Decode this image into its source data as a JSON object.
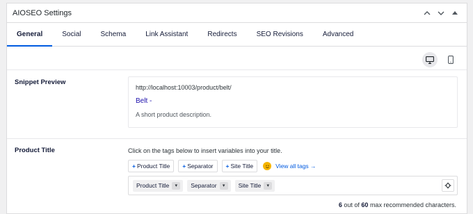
{
  "panel": {
    "title": "AIOSEO Settings"
  },
  "tabs": [
    {
      "label": "General"
    },
    {
      "label": "Social"
    },
    {
      "label": "Schema"
    },
    {
      "label": "Link Assistant"
    },
    {
      "label": "Redirects"
    },
    {
      "label": "SEO Revisions"
    },
    {
      "label": "Advanced"
    }
  ],
  "snippet": {
    "label": "Snippet Preview",
    "url": "http://localhost:10003/product/belt/",
    "title": "Belt -",
    "description": "A short product description."
  },
  "product_title": {
    "label": "Product Title",
    "help": "Click on the tags below to insert variables into your title.",
    "tags": [
      {
        "label": "Product Title"
      },
      {
        "label": "Separator"
      },
      {
        "label": "Site Title"
      }
    ],
    "view_all": "View all tags →",
    "chips": [
      {
        "label": "Product Title"
      },
      {
        "label": "Separator"
      },
      {
        "label": "Site Title"
      }
    ],
    "count": "6",
    "max": "60",
    "count_middle": "out of",
    "count_suffix": "max recommended characters."
  },
  "colors": {
    "accent": "#005ae0",
    "snippet_link": "#1a0dab"
  },
  "icons": [
    "chevron-up-icon",
    "chevron-down-icon",
    "caret-up-icon",
    "desktop-icon",
    "mobile-icon",
    "emoji-icon",
    "settings-icon"
  ]
}
